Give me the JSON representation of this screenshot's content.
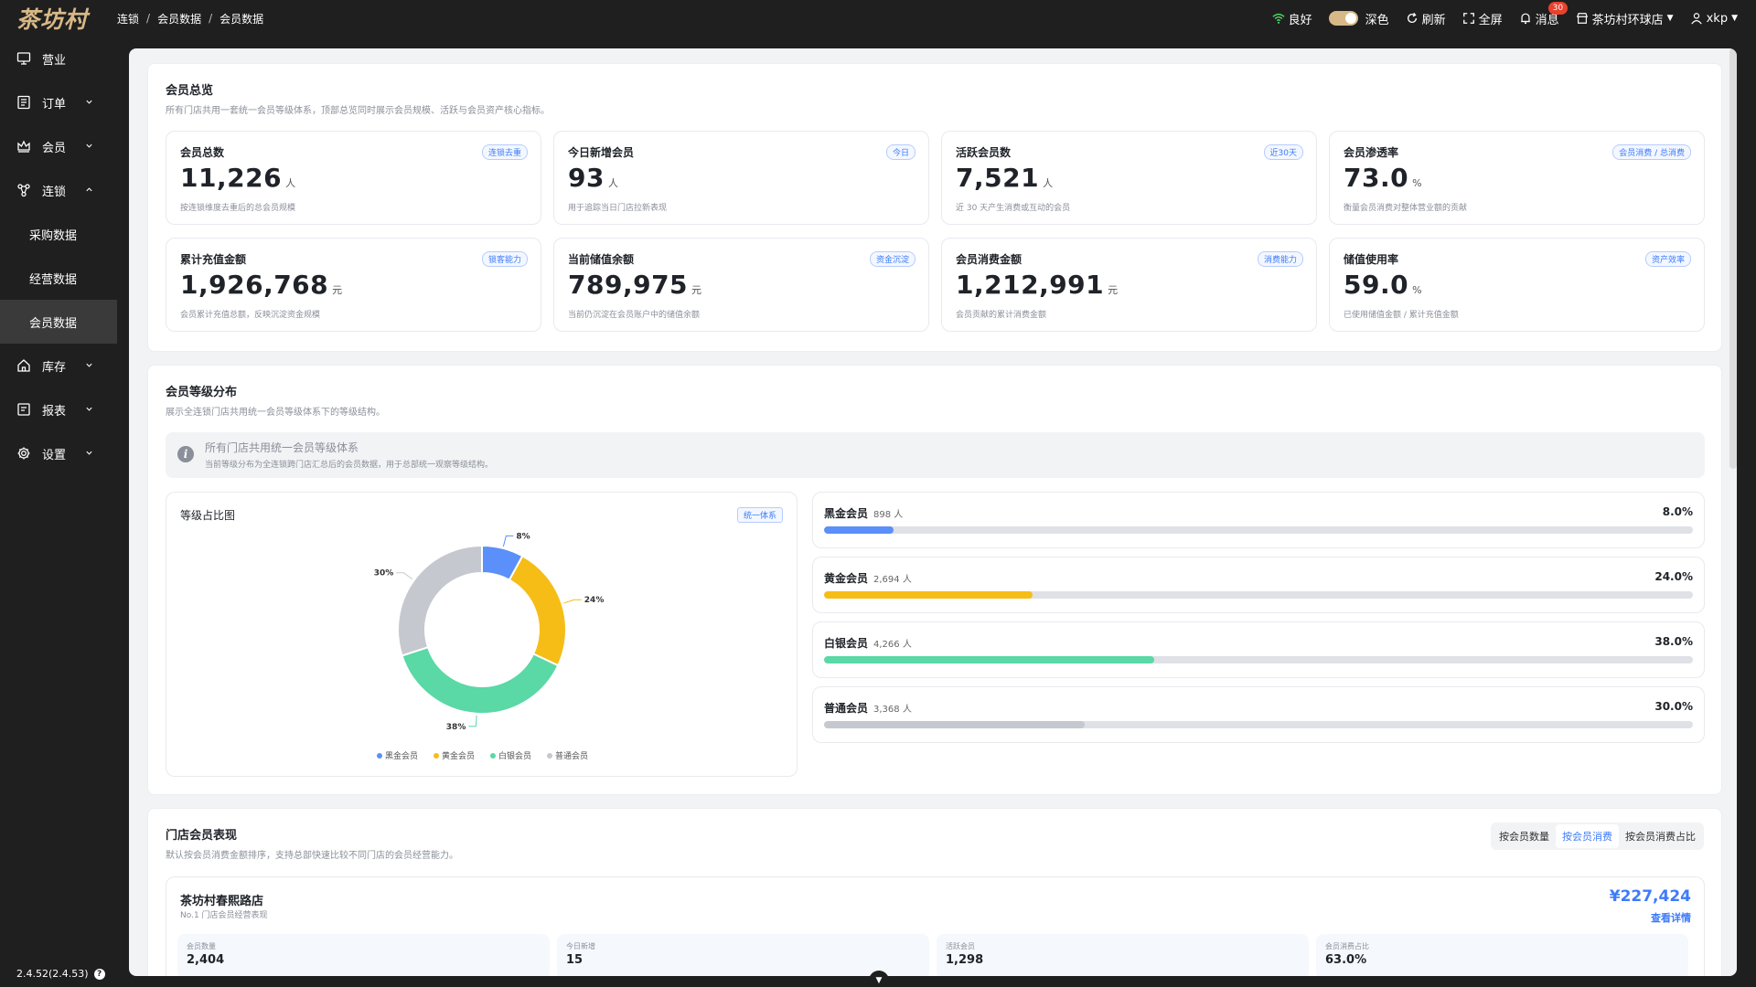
{
  "app": {
    "logo": "茶坊村"
  },
  "breadcrumb": [
    "连锁",
    "会员数据",
    "会员数据"
  ],
  "topbar": {
    "network": "良好",
    "theme": "深色",
    "refresh": "刷新",
    "fullscreen": "全屏",
    "messages": "消息",
    "messages_badge": "30",
    "store": "茶坊村环球店",
    "user": "xkp"
  },
  "sidebar": {
    "items": [
      {
        "label": "营业"
      },
      {
        "label": "订单"
      },
      {
        "label": "会员"
      },
      {
        "label": "连锁"
      },
      {
        "label": "库存"
      },
      {
        "label": "报表"
      },
      {
        "label": "设置"
      }
    ],
    "sub_items": [
      {
        "label": "采购数据"
      },
      {
        "label": "经营数据"
      },
      {
        "label": "会员数据"
      }
    ],
    "version": "2.4.52(2.4.53)"
  },
  "overview": {
    "title": "会员总览",
    "desc": "所有门店共用一套统一会员等级体系，顶部总览同时展示会员规模、活跃与会员资产核心指标。",
    "cards": [
      {
        "label": "会员总数",
        "tag": "连锁去重",
        "value": "11,226",
        "unit": "人",
        "desc": "按连锁维度去重后的总会员规模"
      },
      {
        "label": "今日新增会员",
        "tag": "今日",
        "value": "93",
        "unit": "人",
        "desc": "用于追踪当日门店拉新表现"
      },
      {
        "label": "活跃会员数",
        "tag": "近30天",
        "value": "7,521",
        "unit": "人",
        "desc": "近 30 天产生消费或互动的会员"
      },
      {
        "label": "会员渗透率",
        "tag": "会员消费 / 总消费",
        "value": "73.0",
        "unit": "%",
        "desc": "衡量会员消费对整体营业额的贡献"
      },
      {
        "label": "累计充值金额",
        "tag": "锁客能力",
        "value": "1,926,768",
        "unit": "元",
        "desc": "会员累计充值总额，反映沉淀资金规模"
      },
      {
        "label": "当前储值余额",
        "tag": "资金沉淀",
        "value": "789,975",
        "unit": "元",
        "desc": "当前仍沉淀在会员账户中的储值余额"
      },
      {
        "label": "会员消费金额",
        "tag": "消费能力",
        "value": "1,212,991",
        "unit": "元",
        "desc": "会员贡献的累计消费金额"
      },
      {
        "label": "储值使用率",
        "tag": "资产效率",
        "value": "59.0",
        "unit": "%",
        "desc": "已使用储值金额 / 累计充值金额"
      }
    ]
  },
  "levels": {
    "title": "会员等级分布",
    "desc": "展示全连锁门店共用统一会员等级体系下的等级结构。",
    "notice_title": "所有门店共用统一会员等级体系",
    "notice_desc": "当前等级分布为全连锁跨门店汇总后的会员数据，用于总部统一观察等级结构。",
    "chart_title": "等级占比图",
    "chart_tag": "统一体系",
    "rows": [
      {
        "name": "黑金会员",
        "count": "898 人",
        "pct_label": "8.0%",
        "pct": 8,
        "color": "#5b8ff9"
      },
      {
        "name": "黄金会员",
        "count": "2,694 人",
        "pct_label": "24.0%",
        "pct": 24,
        "color": "#f6bd16"
      },
      {
        "name": "白银会员",
        "count": "4,266 人",
        "pct_label": "38.0%",
        "pct": 38,
        "color": "#5ad8a6"
      },
      {
        "name": "普通会员",
        "count": "3,368 人",
        "pct_label": "30.0%",
        "pct": 30,
        "color": "#c5c8ce"
      }
    ]
  },
  "chart_data": {
    "type": "pie",
    "categories": [
      "黑金会员",
      "黄金会员",
      "白银会员",
      "普通会员"
    ],
    "values": [
      8,
      24,
      38,
      30
    ],
    "labels": [
      "8%",
      "24%",
      "38%",
      "30%"
    ],
    "colors": [
      "#5b8ff9",
      "#f6bd16",
      "#5ad8a6",
      "#c5c8ce"
    ],
    "title": "等级占比图",
    "legend": "bottom"
  },
  "stores": {
    "title": "门店会员表现",
    "desc": "默认按会员消费金额排序，支持总部快速比较不同门店的会员经营能力。",
    "tabs": [
      {
        "label": "按会员数量",
        "active": false
      },
      {
        "label": "按会员消费",
        "active": true
      },
      {
        "label": "按会员消费占比",
        "active": false
      }
    ],
    "top": {
      "name": "茶坊村春熙路店",
      "sub": "No.1 门店会员经营表现",
      "amount": "¥227,424",
      "link": "查看详情",
      "metrics": [
        {
          "label": "会员数量",
          "value": "2,404"
        },
        {
          "label": "今日新增",
          "value": "15"
        },
        {
          "label": "活跃会员",
          "value": "1,298"
        },
        {
          "label": "会员消费占比",
          "value": "63.0%"
        }
      ]
    }
  }
}
